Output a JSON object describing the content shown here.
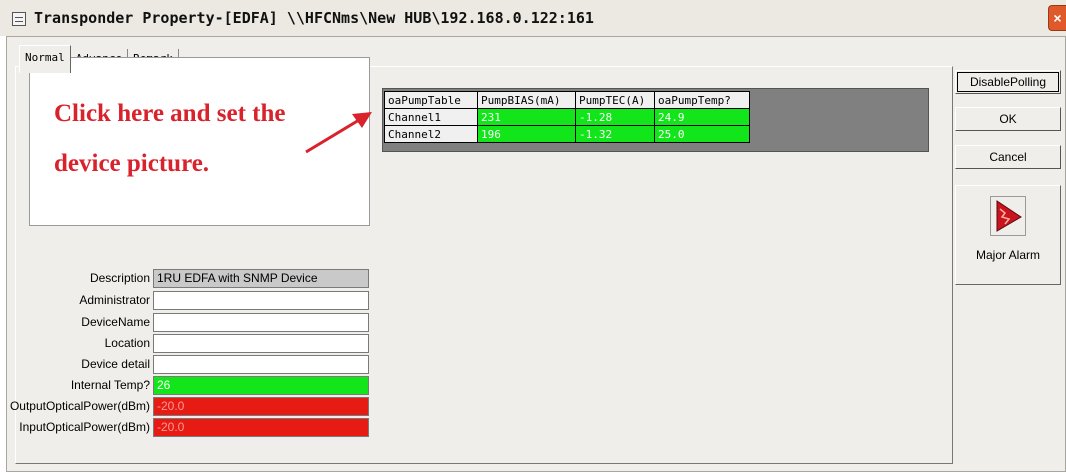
{
  "window": {
    "title": "Transponder Property-[EDFA] \\\\HFCNms\\New HUB\\192.168.0.122:161",
    "close_label": "×"
  },
  "tabs": [
    {
      "label": "Normal",
      "active": true
    },
    {
      "label": "Advance",
      "active": false
    },
    {
      "label": "Remark",
      "active": false
    }
  ],
  "picture": {
    "line1": "Click here and set the",
    "line2": "device picture."
  },
  "properties": [
    {
      "label": "Description",
      "value": "1RU EDFA with SNMP Device",
      "style": "ro"
    },
    {
      "label": "Administrator",
      "value": "",
      "style": "plain"
    },
    {
      "label": "DeviceName",
      "value": "",
      "style": "plain"
    },
    {
      "label": "Location",
      "value": "",
      "style": "plain"
    },
    {
      "label": "Device detail",
      "value": "",
      "style": "plain"
    },
    {
      "label": "Internal Temp?",
      "value": "26",
      "style": "green"
    },
    {
      "label": "OutputOpticalPower(dBm)",
      "value": "-20.0",
      "style": "red"
    },
    {
      "label": "InputOpticalPower(dBm)",
      "value": "-20.0",
      "style": "red"
    }
  ],
  "pump_table": {
    "headers": [
      "oaPumpTable",
      "PumpBIAS(mA)",
      "PumpTEC(A)",
      "oaPumpTemp?"
    ],
    "rows": [
      {
        "name": "Channel1",
        "bias": "231",
        "tec": "-1.28",
        "temp": "24.9"
      },
      {
        "name": "Channel2",
        "bias": "196",
        "tec": "-1.32",
        "temp": "25.0"
      }
    ]
  },
  "buttons": {
    "disable_polling": "DisablePolling",
    "ok": "OK",
    "cancel": "Cancel"
  },
  "alarm": {
    "label": "Major Alarm",
    "icon": "major-alarm-icon",
    "color": "#c8141e"
  },
  "colors": {
    "ok_green": "#12e61a",
    "alarm_red": "#e61b14",
    "annotation_red": "#d8222c"
  }
}
